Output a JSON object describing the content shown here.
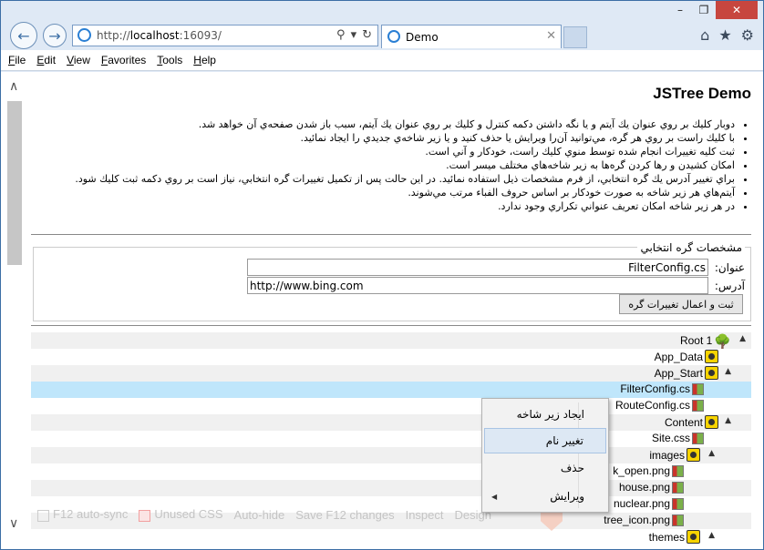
{
  "browser": {
    "url_gray": "http://",
    "url_host": "localhost",
    "url_rest": ":16093/",
    "tab_title": "Demo",
    "window_buttons": [
      "–",
      "❐",
      "✕"
    ],
    "right_icons": [
      "home-icon",
      "star-icon",
      "gear-icon"
    ]
  },
  "menu": [
    "File",
    "Edit",
    "View",
    "Favorites",
    "Tools",
    "Help"
  ],
  "page": {
    "title": "JSTree Demo",
    "notes": [
      "دوبار كليك بر روي عنوان يك آيتم و يا نگه داشتن دكمه كنترل و كليك بر روي عنوان يك آيتم، سبب باز شدن صفحه‌ي آن خواهد شد.",
      "با كليك راست بر روي هر گره، مي‌توانيد آن‌را ويرايش يا حذف كنيد و يا زير شاخه‌ي جديدي را ايجاد نمائيد.",
      "ثبت كليه تغييرات انجام شده توسط منوي كليك راست، خودكار و آني است.",
      "امكان كشيدن و رها كردن گره‌ها به زير شاخه‌هاي مختلف ميسر است.",
      "براي تغيير آدرس يك گره انتخابي، از فرم مشخصات ذيل استفاده نمائيد. در اين حالت پس از تكميل تغييرات گره انتخابي، نياز است بر روي دكمه ثبت كليك شود.",
      "آيتم‌هاي هر زير شاخه به صورت خودكار بر اساس حروف الفباء مرتب مي‌شوند.",
      "در هر زير شاخه امكان تعريف عنواني تكراري وجود ندارد."
    ],
    "props": {
      "legend": "مشخصات گره انتخابي",
      "title_label": "عنوان:",
      "title_value": "FilterConfig.cs",
      "url_label": "آدرس:",
      "url_value": "http://www.bing.com",
      "submit": "ثبت و اعمال تغييرات گره"
    }
  },
  "tree": [
    {
      "label": "Root 1",
      "icon": "tree-icon",
      "arrow": "▲"
    },
    {
      "label": "App_Data",
      "icon": "folder-icon",
      "arrow": ""
    },
    {
      "label": "App_Start",
      "icon": "folder-icon",
      "arrow": "▲"
    },
    {
      "label": "FilterConfig.cs",
      "icon": "file-icon",
      "arrow": ""
    },
    {
      "label": "RouteConfig.cs",
      "icon": "file-icon",
      "arrow": ""
    },
    {
      "label": "Content",
      "icon": "folder-icon",
      "arrow": "▲"
    },
    {
      "label": "Site.css",
      "icon": "file-icon",
      "arrow": ""
    },
    {
      "label": "images",
      "icon": "folder-icon",
      "arrow": "▲"
    },
    {
      "label": "k_open.png",
      "icon": "file-icon",
      "arrow": ""
    },
    {
      "label": "house.png",
      "icon": "file-icon",
      "arrow": ""
    },
    {
      "label": "nuclear.png",
      "icon": "file-icon",
      "arrow": ""
    },
    {
      "label": "tree_icon.png",
      "icon": "file-icon",
      "arrow": ""
    },
    {
      "label": "themes",
      "icon": "folder-icon",
      "arrow": "▲"
    }
  ],
  "context_menu": [
    "ايجاد زير شاخه",
    "تغيير نام",
    "حذف",
    "ويرايش"
  ],
  "f12_bar": [
    "F12 auto-sync",
    "Unused CSS",
    "Auto-hide",
    "Save F12 changes",
    "Inspect",
    "Design"
  ]
}
